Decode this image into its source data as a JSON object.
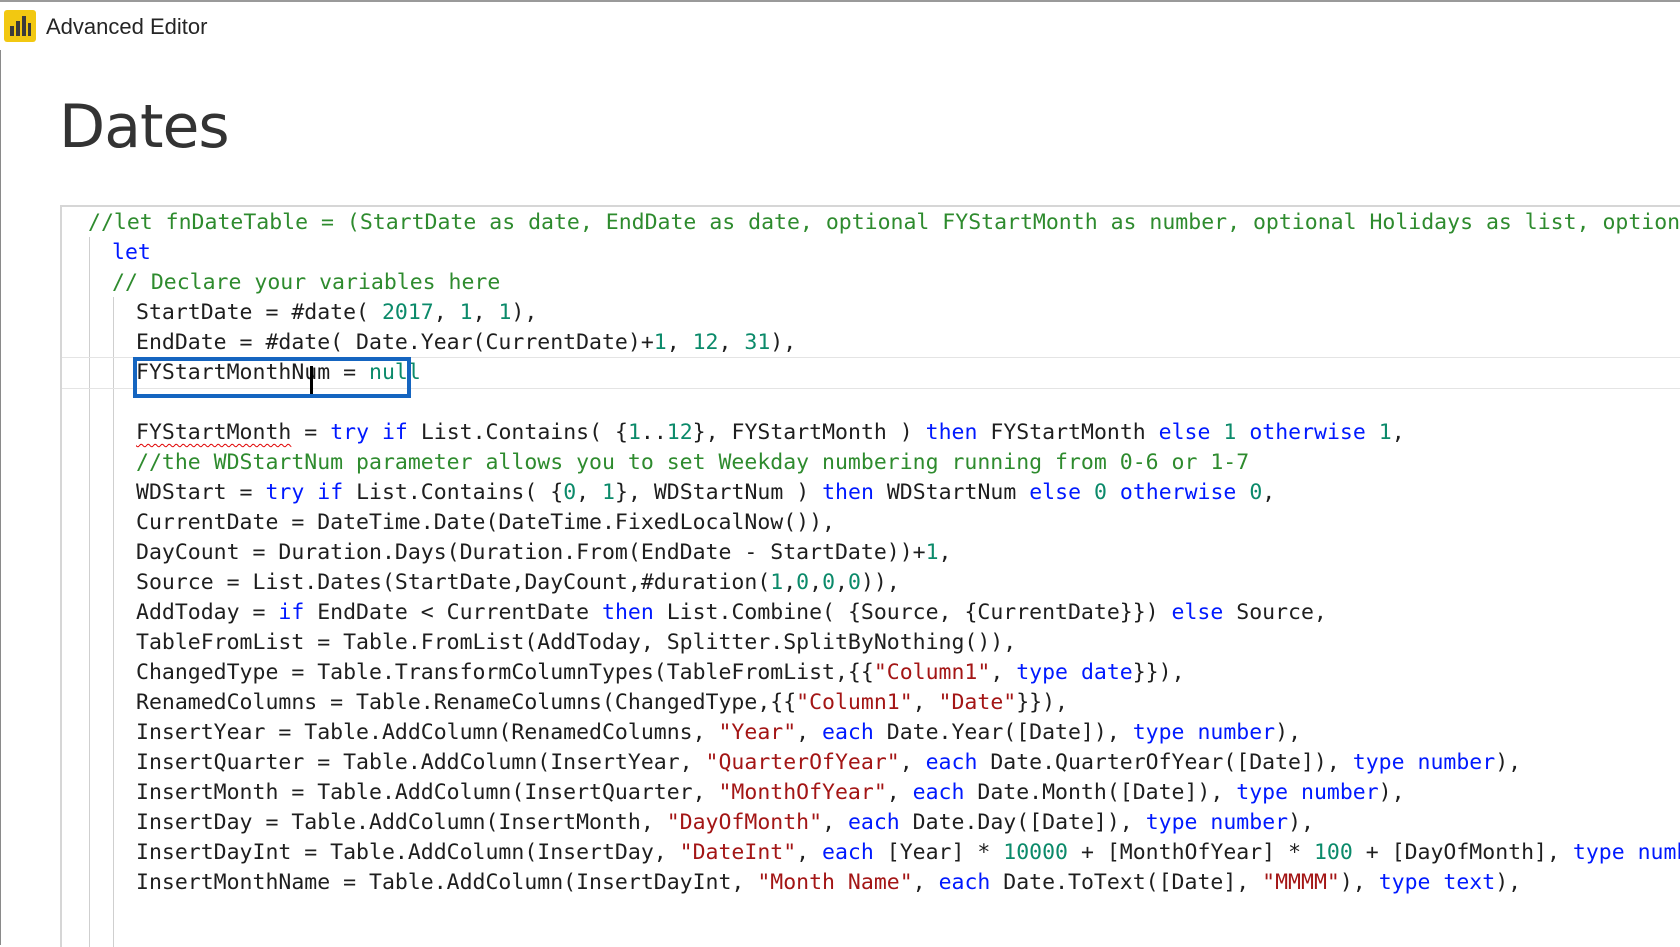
{
  "window": {
    "title": "Advanced Editor",
    "app_icon": "power-bi-icon",
    "accent_color": "#f2c811"
  },
  "query": {
    "name": "Dates"
  },
  "colors": {
    "keyword": "#0019ff",
    "number": "#0b8a6a",
    "string": "#a31515",
    "comment": "#2e8b2e",
    "plain": "#1e1e1e",
    "highlight_box": "#1565c0"
  },
  "editor": {
    "current_line_index": 5,
    "lines": [
      {
        "indent": 0,
        "tokens": [
          [
            "c",
            "//let fnDateTable = (StartDate as date, EndDate as date, optional FYStartMonth as number, optional Holidays as list, optiona"
          ]
        ]
      },
      {
        "indent": 1,
        "tokens": [
          [
            "k",
            "let"
          ]
        ]
      },
      {
        "indent": 1,
        "tokens": [
          [
            "c",
            "// Declare your variables here"
          ]
        ]
      },
      {
        "indent": 2,
        "tokens": [
          [
            "p",
            "StartDate = #date( "
          ],
          [
            "n",
            "2017"
          ],
          [
            "p",
            ", "
          ],
          [
            "n",
            "1"
          ],
          [
            "p",
            ", "
          ],
          [
            "n",
            "1"
          ],
          [
            "p",
            "),"
          ]
        ]
      },
      {
        "indent": 2,
        "tokens": [
          [
            "p",
            "EndDate = #date( Date.Year(CurrentDate)+"
          ],
          [
            "n",
            "1"
          ],
          [
            "p",
            ", "
          ],
          [
            "n",
            "12"
          ],
          [
            "p",
            ", "
          ],
          [
            "n",
            "31"
          ],
          [
            "p",
            "),"
          ]
        ]
      },
      {
        "indent": 2,
        "tokens": [
          [
            "p",
            "FYStartMonthNum = "
          ],
          [
            "n",
            "null"
          ]
        ]
      },
      {
        "indent": 2,
        "tokens": []
      },
      {
        "indent": 2,
        "tokens": [
          [
            "sq",
            "FYStartMonth"
          ],
          [
            "p",
            " = "
          ],
          [
            "k",
            "try"
          ],
          [
            "p",
            " "
          ],
          [
            "k",
            "if"
          ],
          [
            "p",
            " List.Contains( {"
          ],
          [
            "n",
            "1"
          ],
          [
            "p",
            ".."
          ],
          [
            "n",
            "12"
          ],
          [
            "p",
            "}, FYStartMonth ) "
          ],
          [
            "k",
            "then"
          ],
          [
            "p",
            " FYStartMonth "
          ],
          [
            "k",
            "else"
          ],
          [
            "p",
            " "
          ],
          [
            "n",
            "1"
          ],
          [
            "p",
            " "
          ],
          [
            "k",
            "otherwise"
          ],
          [
            "p",
            " "
          ],
          [
            "n",
            "1"
          ],
          [
            "p",
            ","
          ]
        ]
      },
      {
        "indent": 2,
        "tokens": [
          [
            "c",
            "//the WDStartNum parameter allows you to set Weekday numbering running from 0-6 or 1-7"
          ]
        ]
      },
      {
        "indent": 2,
        "tokens": [
          [
            "p",
            "WDStart = "
          ],
          [
            "k",
            "try"
          ],
          [
            "p",
            " "
          ],
          [
            "k",
            "if"
          ],
          [
            "p",
            " List.Contains( {"
          ],
          [
            "n",
            "0"
          ],
          [
            "p",
            ", "
          ],
          [
            "n",
            "1"
          ],
          [
            "p",
            "}, WDStartNum ) "
          ],
          [
            "k",
            "then"
          ],
          [
            "p",
            " WDStartNum "
          ],
          [
            "k",
            "else"
          ],
          [
            "p",
            " "
          ],
          [
            "n",
            "0"
          ],
          [
            "p",
            " "
          ],
          [
            "k",
            "otherwise"
          ],
          [
            "p",
            " "
          ],
          [
            "n",
            "0"
          ],
          [
            "p",
            ","
          ]
        ]
      },
      {
        "indent": 2,
        "tokens": [
          [
            "p",
            "CurrentDate = DateTime.Date(DateTime.FixedLocalNow()),"
          ]
        ]
      },
      {
        "indent": 2,
        "tokens": [
          [
            "p",
            "DayCount = Duration.Days(Duration.From(EndDate - StartDate))+"
          ],
          [
            "n",
            "1"
          ],
          [
            "p",
            ","
          ]
        ]
      },
      {
        "indent": 2,
        "tokens": [
          [
            "p",
            "Source = List.Dates(StartDate,DayCount,#duration("
          ],
          [
            "n",
            "1"
          ],
          [
            "p",
            ","
          ],
          [
            "n",
            "0"
          ],
          [
            "p",
            ","
          ],
          [
            "n",
            "0"
          ],
          [
            "p",
            ","
          ],
          [
            "n",
            "0"
          ],
          [
            "p",
            ")),"
          ]
        ]
      },
      {
        "indent": 2,
        "tokens": [
          [
            "p",
            "AddToday = "
          ],
          [
            "k",
            "if"
          ],
          [
            "p",
            " EndDate < CurrentDate "
          ],
          [
            "k",
            "then"
          ],
          [
            "p",
            " List.Combine( {Source, {CurrentDate}}) "
          ],
          [
            "k",
            "else"
          ],
          [
            "p",
            " Source,"
          ]
        ]
      },
      {
        "indent": 2,
        "tokens": [
          [
            "p",
            "TableFromList = Table.FromList(AddToday, Splitter.SplitByNothing()),"
          ]
        ]
      },
      {
        "indent": 2,
        "tokens": [
          [
            "p",
            "ChangedType = Table.TransformColumnTypes(TableFromList,{{"
          ],
          [
            "s",
            "\"Column1\""
          ],
          [
            "p",
            ", "
          ],
          [
            "k",
            "type"
          ],
          [
            "p",
            " "
          ],
          [
            "k",
            "date"
          ],
          [
            "p",
            "}}),"
          ]
        ]
      },
      {
        "indent": 2,
        "tokens": [
          [
            "p",
            "RenamedColumns = Table.RenameColumns(ChangedType,{{"
          ],
          [
            "s",
            "\"Column1\""
          ],
          [
            "p",
            ", "
          ],
          [
            "s",
            "\"Date\""
          ],
          [
            "p",
            "}}),"
          ]
        ]
      },
      {
        "indent": 2,
        "tokens": [
          [
            "p",
            "InsertYear = Table.AddColumn(RenamedColumns, "
          ],
          [
            "s",
            "\"Year\""
          ],
          [
            "p",
            ", "
          ],
          [
            "k",
            "each"
          ],
          [
            "p",
            " Date.Year([Date]), "
          ],
          [
            "k",
            "type"
          ],
          [
            "p",
            " "
          ],
          [
            "k",
            "number"
          ],
          [
            "p",
            "),"
          ]
        ]
      },
      {
        "indent": 2,
        "tokens": [
          [
            "p",
            "InsertQuarter = Table.AddColumn(InsertYear, "
          ],
          [
            "s",
            "\"QuarterOfYear\""
          ],
          [
            "p",
            ", "
          ],
          [
            "k",
            "each"
          ],
          [
            "p",
            " Date.QuarterOfYear([Date]), "
          ],
          [
            "k",
            "type"
          ],
          [
            "p",
            " "
          ],
          [
            "k",
            "number"
          ],
          [
            "p",
            "),"
          ]
        ]
      },
      {
        "indent": 2,
        "tokens": [
          [
            "p",
            "InsertMonth = Table.AddColumn(InsertQuarter, "
          ],
          [
            "s",
            "\"MonthOfYear\""
          ],
          [
            "p",
            ", "
          ],
          [
            "k",
            "each"
          ],
          [
            "p",
            " Date.Month([Date]), "
          ],
          [
            "k",
            "type"
          ],
          [
            "p",
            " "
          ],
          [
            "k",
            "number"
          ],
          [
            "p",
            "),"
          ]
        ]
      },
      {
        "indent": 2,
        "tokens": [
          [
            "p",
            "InsertDay = Table.AddColumn(InsertMonth, "
          ],
          [
            "s",
            "\"DayOfMonth\""
          ],
          [
            "p",
            ", "
          ],
          [
            "k",
            "each"
          ],
          [
            "p",
            " Date.Day([Date]), "
          ],
          [
            "k",
            "type"
          ],
          [
            "p",
            " "
          ],
          [
            "k",
            "number"
          ],
          [
            "p",
            "),"
          ]
        ]
      },
      {
        "indent": 2,
        "tokens": [
          [
            "p",
            "InsertDayInt = Table.AddColumn(InsertDay, "
          ],
          [
            "s",
            "\"DateInt\""
          ],
          [
            "p",
            ", "
          ],
          [
            "k",
            "each"
          ],
          [
            "p",
            " [Year] * "
          ],
          [
            "n",
            "10000"
          ],
          [
            "p",
            " + [MonthOfYear] * "
          ],
          [
            "n",
            "100"
          ],
          [
            "p",
            " + [DayOfMonth], "
          ],
          [
            "k",
            "type"
          ],
          [
            "p",
            " "
          ],
          [
            "k",
            "numb"
          ]
        ]
      },
      {
        "indent": 2,
        "tokens": [
          [
            "p",
            "InsertMonthName = Table.AddColumn(InsertDayInt, "
          ],
          [
            "s",
            "\"Month Name\""
          ],
          [
            "p",
            ", "
          ],
          [
            "k",
            "each"
          ],
          [
            "p",
            " Date.ToText([Date], "
          ],
          [
            "s",
            "\"MMMM\""
          ],
          [
            "p",
            "), "
          ],
          [
            "k",
            "type"
          ],
          [
            "p",
            " "
          ],
          [
            "k",
            "text"
          ],
          [
            "p",
            "),"
          ]
        ]
      }
    ]
  }
}
